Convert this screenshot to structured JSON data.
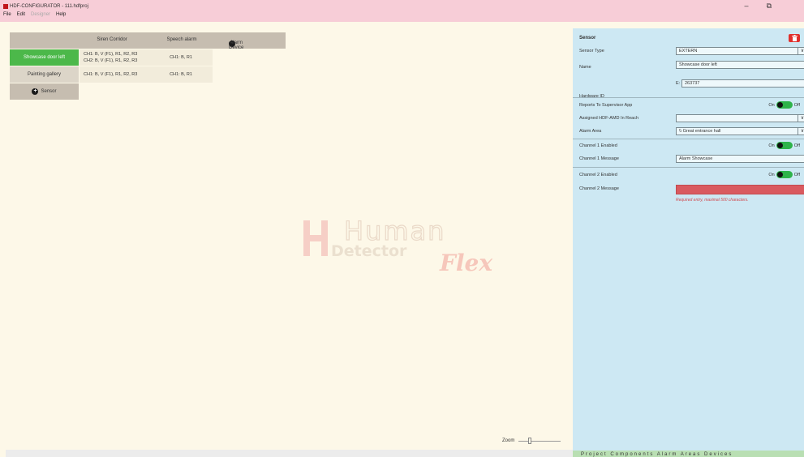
{
  "window": {
    "title": "HDF-CONFIGURATOR - 111.hdfproj",
    "minimize_glyph": "–",
    "restore_glyph": "⧉"
  },
  "menu": [
    "File",
    "Edit",
    "Designer",
    "Help"
  ],
  "grid": {
    "columns": [
      "Siren Corridor",
      "Speech alarm"
    ],
    "add_alarm_device_label": "Alarm Device",
    "rows": [
      {
        "label": "Showcase door left",
        "siren": [
          "CH1:  B, V (F1), R1, R2, R3",
          "CH2:  B, V (F1), R1, R2, R3"
        ],
        "speech": "CH1:  B, R1"
      },
      {
        "label": "Painting gallery",
        "siren": [
          "CH1:  B, V (F1), R1, R2, R3"
        ],
        "speech": "CH1:  B, R1"
      }
    ],
    "add_sensor_label": "Sensor"
  },
  "watermark": {
    "line1": "Human",
    "line2": "Detector",
    "line3": "Flex"
  },
  "zoom": {
    "label": "Zoom",
    "value": 0.25
  },
  "panel": {
    "title": "Sensor",
    "sensor_type_label": "Sensor Type",
    "sensor_type_value": "EXTERN",
    "name_label": "Name",
    "name_value": "Showcase door left",
    "hardware_id_label": "Hardware ID",
    "hardware_id_prefix": "E:",
    "hardware_id_value": "263737",
    "reports_label": "Reports To Supervisor App",
    "assigned_label": "Assigned HDF-AMD In Reach",
    "assigned_value": "",
    "alarm_area_label": "Alarm Area",
    "alarm_area_value": "\\\\ Great entrance hall",
    "ch1_enabled_label": "Channel 1 Enabled",
    "ch1_message_label": "Channel 1 Message",
    "ch1_message_value": "Alarm Showcase",
    "ch2_enabled_label": "Channel 2 Enabled",
    "ch2_message_label": "Channel 2 Message",
    "ch2_message_value": "",
    "error_text": "Required entry, maximal 500 characters.",
    "toggle_on": "On",
    "toggle_off": "Off",
    "footer_text": "Project  Components  Alarm  Areas  Devices"
  },
  "colors": {
    "titlebar": "#f7cdd7",
    "canvas": "#fdf8e8",
    "panel": "#cde8f3",
    "selected_row": "#4cb84a",
    "toggle_on": "#2eb34a",
    "error": "#d95a5f",
    "delete": "#e0302c"
  }
}
